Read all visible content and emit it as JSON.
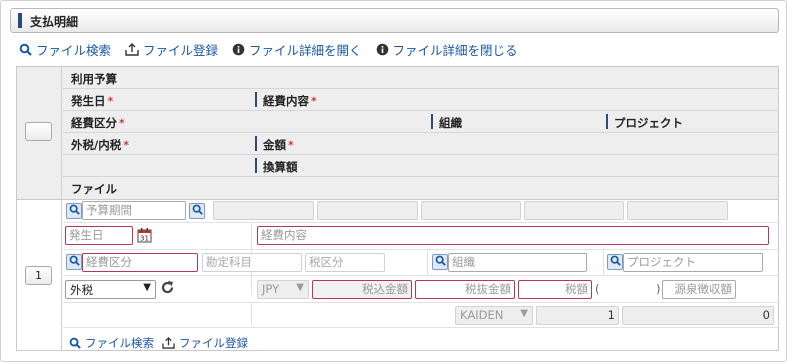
{
  "section": {
    "title": "支払明細"
  },
  "toolbar": {
    "file_search": "ファイル検索",
    "file_register": "ファイル登録",
    "file_detail_open": "ファイル詳細を開く",
    "file_detail_close": "ファイル詳細を閉じる"
  },
  "header": {
    "budget": "利用予算",
    "date": "発生日",
    "content": "経費内容",
    "category": "経費区分",
    "org": "組織",
    "project": "プロジェクト",
    "tax_type": "外税/内税",
    "amount": "金額",
    "converted": "換算額",
    "file": "ファイル",
    "required_mark": "*"
  },
  "row": {
    "number": "1",
    "budget_period_placeholder": "予算期間",
    "date_placeholder": "発生日",
    "content_placeholder": "経費内容",
    "category_placeholder": "経費区分",
    "account_placeholder": "勘定科目",
    "tax_class_placeholder": "税区分",
    "org_placeholder": "組織",
    "project_placeholder": "プロジェクト",
    "tax_type_value": "外税",
    "currency": "JPY",
    "tax_incl_placeholder": "税込金額",
    "tax_excl_placeholder": "税抜金額",
    "tax_placeholder": "税額",
    "paren_open": "(",
    "paren_close": ")",
    "withholding_placeholder": "源泉徴収額",
    "rate_type": "KAIDEN",
    "rate_value": "1",
    "converted_value": "0"
  },
  "footer": {
    "file_search": "ファイル検索",
    "file_register": "ファイル登録"
  },
  "colors": {
    "accent": "#2c4a7a",
    "link": "#1a57a5",
    "required_border": "#b5385a"
  }
}
